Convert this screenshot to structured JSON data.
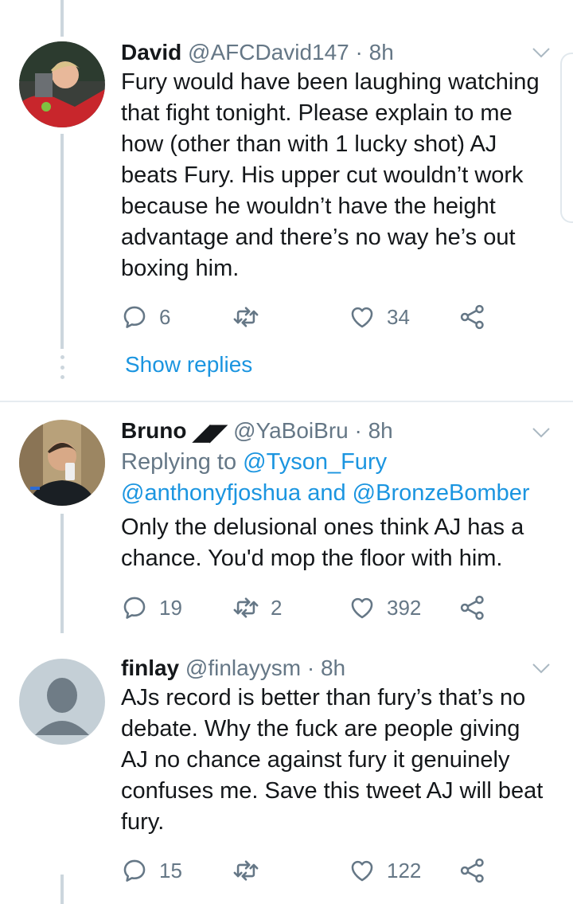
{
  "tweets": [
    {
      "name": "David",
      "handle": "@AFCDavid147",
      "sep": "·",
      "time": "8h",
      "text": "Fury would have been laughing watching that fight tonight. Please explain to me how (other than with 1 lucky shot) AJ beats Fury. His upper cut wouldn’t work because he wouldn’t have the height advantage and there’s no way he’s out boxing him.",
      "replies": "6",
      "retweets": "",
      "likes": "34",
      "show_replies": "Show replies"
    },
    {
      "name": "Bruno",
      "badge_glyphs": "◢◤",
      "handle": "@YaBoiBru",
      "sep": "·",
      "time": "8h",
      "replying_prefix": "Replying to ",
      "reply_mention_1": "@Tyson_Fury",
      "reply_mention_2": "@anthonyfjoshua",
      "reply_and": " and ",
      "reply_mention_3": "@BronzeBomber",
      "text": "Only the delusional ones think AJ has a chance. You'd mop the floor with him.",
      "replies": "19",
      "retweets": "2",
      "likes": "392"
    },
    {
      "name": "finlay",
      "handle": "@finlayysm",
      "sep": "·",
      "time": "8h",
      "text": "AJs record is better than fury’s that’s no debate. Why the fuck are people giving AJ no chance against fury it genuinely confuses me. Save this tweet AJ will beat fury.",
      "replies": "15",
      "retweets": "",
      "likes": "122"
    }
  ],
  "icons": {
    "reply": "reply-icon",
    "retweet": "retweet-icon",
    "like": "heart-icon",
    "share": "share-icon",
    "caret": "chevron-down-icon"
  },
  "colors": {
    "link": "#1b95e0",
    "muted": "#657786",
    "text": "#14171a",
    "thread_line": "#ccd6dd"
  }
}
